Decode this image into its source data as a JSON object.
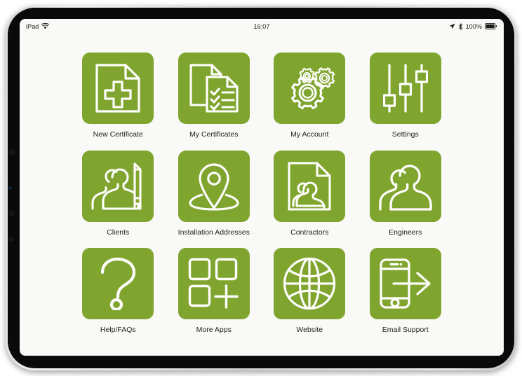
{
  "device": {
    "name": "iPad",
    "frame_color": "#d8d8d8",
    "bezel_color": "#0a0a0a"
  },
  "status_bar": {
    "carrier_label": "iPad",
    "wifi_icon": "wifi-icon",
    "time": "16:07",
    "location_icon": "location-arrow-icon",
    "bluetooth_icon": "bluetooth-icon",
    "battery_percent": "100%",
    "battery_icon": "battery-full-icon"
  },
  "theme": {
    "tile_green": "#7FA52E",
    "icon_stroke": "#ffffff",
    "screen_bg": "#f9f9f7",
    "label_color": "#1d1d1d"
  },
  "grid": {
    "columns": 4,
    "tiles": [
      {
        "id": "new-certificate",
        "label": "New Certificate",
        "icon": "document-plus-icon"
      },
      {
        "id": "my-certificates",
        "label": "My Certificates",
        "icon": "documents-checklist-icon"
      },
      {
        "id": "my-account",
        "label": "My Account",
        "icon": "gears-icon"
      },
      {
        "id": "settings",
        "label": "Settings",
        "icon": "sliders-icon"
      },
      {
        "id": "clients",
        "label": "Clients",
        "icon": "people-pencil-icon"
      },
      {
        "id": "installation-addresses",
        "label": "Installation Addresses",
        "icon": "map-pin-icon"
      },
      {
        "id": "contractors",
        "label": "Contractors",
        "icon": "document-people-icon"
      },
      {
        "id": "engineers",
        "label": "Engineers",
        "icon": "people-icon"
      },
      {
        "id": "help-faqs",
        "label": "Help/FAQs",
        "icon": "question-mark-icon"
      },
      {
        "id": "more-apps",
        "label": "More Apps",
        "icon": "grid-plus-icon"
      },
      {
        "id": "website",
        "label": "Website",
        "icon": "globe-icon"
      },
      {
        "id": "email-support",
        "label": "Email Support",
        "icon": "phone-arrow-icon"
      }
    ]
  }
}
